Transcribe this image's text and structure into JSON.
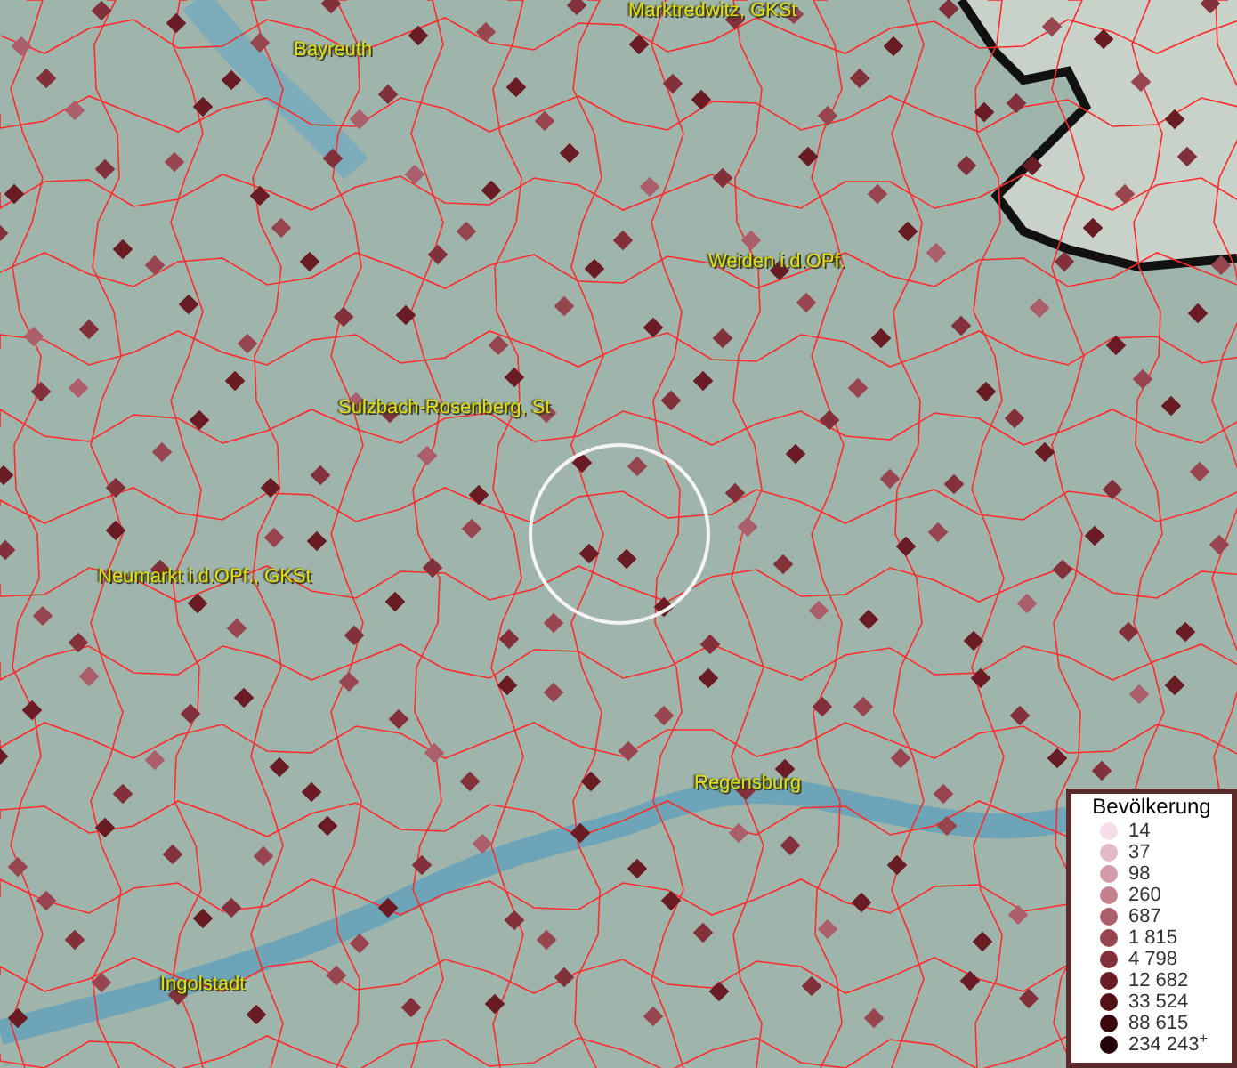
{
  "map": {
    "places": [
      {
        "label": "Marktredwitz, GKSt"
      },
      {
        "label": "Bayreuth"
      },
      {
        "label": "Weiden i.d.OPf."
      },
      {
        "label": "Sulzbach-Rosenberg, St"
      },
      {
        "label": "Neumarkt i.d.OPf., GKSt"
      },
      {
        "label": "Regensburg"
      },
      {
        "label": "Ingolstadt"
      }
    ]
  },
  "legend": {
    "title": "Bevölkerung",
    "items": [
      {
        "label": "14",
        "color": "#f4dde8"
      },
      {
        "label": "37",
        "color": "#e3b9c6"
      },
      {
        "label": "98",
        "color": "#d49ca8"
      },
      {
        "label": "260",
        "color": "#c3818d"
      },
      {
        "label": "687",
        "color": "#ab5f6b"
      },
      {
        "label": "1 815",
        "color": "#974650"
      },
      {
        "label": "4 798",
        "color": "#82303a"
      },
      {
        "label": "12 682",
        "color": "#6a1c24"
      },
      {
        "label": "33 524",
        "color": "#521017"
      },
      {
        "label": "88 615",
        "color": "#3a070c"
      },
      {
        "label": "234 243$^{+}$",
        "color": "#260306"
      }
    ]
  }
}
